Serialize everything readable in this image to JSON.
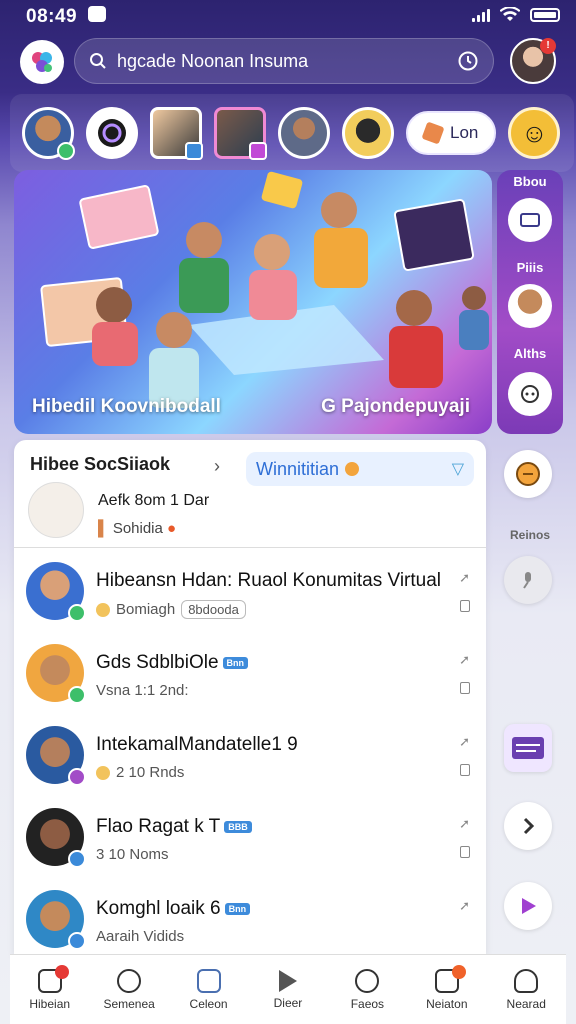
{
  "status": {
    "time": "08:49"
  },
  "search": {
    "placeholder": "hgcade Noonan Insuma"
  },
  "stories": {
    "pill_label": "Lon"
  },
  "hero": {
    "caption_left": "Hibedil Koovnibodall",
    "caption_right": "G Pajondepuyaji"
  },
  "side_panel": {
    "label1": "Bbou",
    "label2": "Piiis",
    "label3": "Alths"
  },
  "feed": {
    "tab1": "Hibee SocSiiaok",
    "tab2": "Winnititian",
    "compose_title": "Aefk 8om 1 Dar",
    "compose_sub": "Sohidia",
    "posts": [
      {
        "title": "Hibeansn Hdan: Ruaol Konumitas Virtual",
        "meta": "Bomiagh",
        "chip": "8bdooda",
        "tag": ""
      },
      {
        "title": "Gds SdblbiOle",
        "meta": "Vsna 1:1 2nd:",
        "chip": "",
        "tag": "Bnn"
      },
      {
        "title": "IntekamalMandatelle1 9",
        "meta": "2 10 Rnds",
        "chip": "",
        "tag": ""
      },
      {
        "title": "Flao Ragat k T",
        "meta": "3 10 Noms",
        "chip": "",
        "tag": "BBB"
      },
      {
        "title": "Komghl loaik 6",
        "meta": "Aaraih Vidids",
        "chip": "",
        "tag": "Bnn"
      }
    ]
  },
  "rail": {
    "label_mid": "Reinos"
  },
  "nav": [
    {
      "label": "Hibeian"
    },
    {
      "label": "Semenea"
    },
    {
      "label": "Celeon"
    },
    {
      "label": "Dieer"
    },
    {
      "label": "Faeos"
    },
    {
      "label": "Neiaton"
    },
    {
      "label": "Nearad"
    }
  ]
}
